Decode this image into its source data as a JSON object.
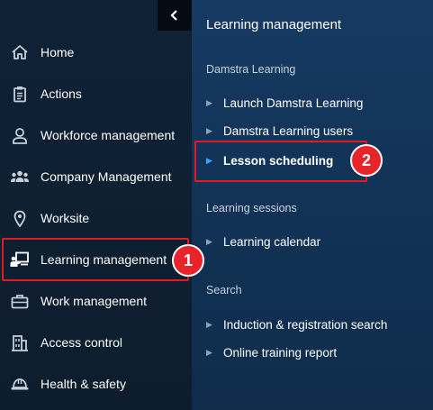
{
  "sidebar": {
    "collapse_icon": "chevron-left-icon",
    "items": [
      {
        "label": "Home",
        "icon": "home-icon"
      },
      {
        "label": "Actions",
        "icon": "clipboard-icon"
      },
      {
        "label": "Workforce management",
        "icon": "person-icon"
      },
      {
        "label": "Company Management",
        "icon": "group-icon"
      },
      {
        "label": "Worksite",
        "icon": "location-pin-icon"
      },
      {
        "label": "Learning management",
        "icon": "presentation-icon"
      },
      {
        "label": "Work management",
        "icon": "briefcase-icon"
      },
      {
        "label": "Access control",
        "icon": "building-icon"
      },
      {
        "label": "Health & safety",
        "icon": "hard-hat-icon"
      }
    ]
  },
  "panel": {
    "title": "Learning management",
    "sections": [
      {
        "heading": "Damstra Learning",
        "links": [
          "Launch Damstra Learning",
          "Damstra Learning users",
          "Lesson scheduling"
        ]
      },
      {
        "heading": "Learning sessions",
        "links": [
          "Learning calendar"
        ]
      },
      {
        "heading": "Search",
        "links": [
          "Induction & registration search",
          "Online training report"
        ]
      }
    ]
  },
  "annotations": {
    "badge_1": "1",
    "badge_2": "2",
    "highlight_color": "#e01b22"
  },
  "colors": {
    "sidebar_bg": "#0f2236",
    "panel_bg": "#163a63",
    "active_chevron": "#3da5ff",
    "badge": "#e8232a"
  }
}
